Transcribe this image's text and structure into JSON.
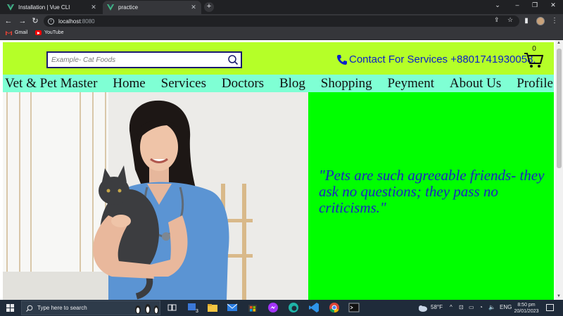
{
  "browser": {
    "tabs": [
      {
        "label": "Installation | Vue CLI"
      },
      {
        "label": "practice"
      }
    ],
    "url_host": "localhost",
    "url_port": ":8080",
    "bookmarks": [
      {
        "label": "Gmail",
        "icon": "gmail-icon"
      },
      {
        "label": "YouTube",
        "icon": "youtube-icon"
      }
    ]
  },
  "page": {
    "search_placeholder": "Example- Cat Foods",
    "contact_text": "Contact For Services +8801741930058.",
    "cart_count": "0",
    "nav": [
      "Vet & Pet Master",
      "Home",
      "Services",
      "Doctors",
      "Blog",
      "Shopping",
      "Peyment",
      "About Us",
      "Profile"
    ],
    "quote": "\"Pets are such agreeable friends- they ask no questions; they pass no criticisms.\"",
    "colors": {
      "header_bg": "#b5ff28",
      "nav_bg": "#7fffd4",
      "quote_bg": "#00ff00",
      "accent_blue": "#0b21c9"
    }
  },
  "taskbar": {
    "search_placeholder": "Type here to search",
    "badge": "30",
    "weather": "58°F",
    "lang": "ENG",
    "time": "8:50 pm",
    "date": "20/01/2023"
  }
}
